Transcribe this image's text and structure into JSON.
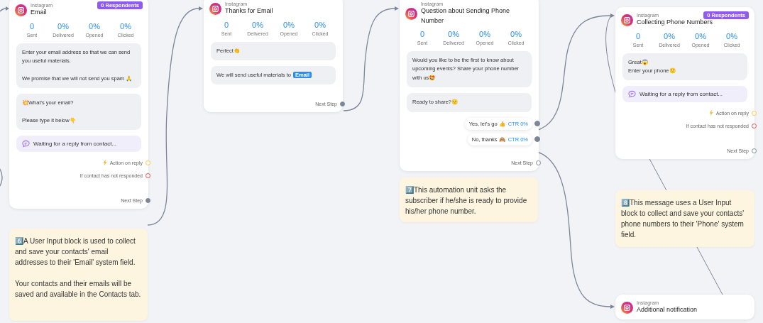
{
  "nodes": [
    {
      "platform": "Instagram",
      "title": "Email",
      "badge": "0 Respondents",
      "stats": [
        {
          "value": "0",
          "label": "Sent"
        },
        {
          "value": "0%",
          "label": "Delivered"
        },
        {
          "value": "0%",
          "label": "Opened"
        },
        {
          "value": "0%",
          "label": "Clicked"
        }
      ],
      "messages": [
        {
          "text": "Enter your email address so that we can send you useful materials.\n\nWe promise that we will not send you spam 🙏"
        },
        {
          "text": "💥What's your email?\n\nPlease type it below👇"
        }
      ],
      "waiting": "Waiting for a reply from contact...",
      "outputs": [
        {
          "kind": "action",
          "label": "Action on reply",
          "connected": false
        },
        {
          "kind": "no-response",
          "label": "If contact has not responded",
          "connected": false
        },
        {
          "kind": "next",
          "label": "Next Step",
          "connected": true
        }
      ]
    },
    {
      "platform": "Instagram",
      "title": "Thanks for Email",
      "stats": [
        {
          "value": "0",
          "label": "Sent"
        },
        {
          "value": "0%",
          "label": "Delivered"
        },
        {
          "value": "0%",
          "label": "Opened"
        },
        {
          "value": "0%",
          "label": "Clicked"
        }
      ],
      "messages": [
        {
          "text": "Perfect👏"
        },
        {
          "text": "We will send useful materials to ",
          "tag": "Email"
        }
      ],
      "outputs": [
        {
          "kind": "next",
          "label": "Next Step",
          "connected": true
        }
      ]
    },
    {
      "platform": "Instagram",
      "title": "Question about Sending Phone Number",
      "stats": [
        {
          "value": "0",
          "label": "Sent"
        },
        {
          "value": "0%",
          "label": "Delivered"
        },
        {
          "value": "0%",
          "label": "Opened"
        },
        {
          "value": "0%",
          "label": "Clicked"
        }
      ],
      "messages": [
        {
          "text": "Would you like to be the first to know about upcoming events? Share your phone number with us🤩"
        },
        {
          "text": "Ready to share?🙂"
        }
      ],
      "buttons": [
        {
          "label": "Yes, let's go 👍",
          "ctr": "CTR 0%"
        },
        {
          "label": "No, thanks 🙈",
          "ctr": "CTR 0%"
        }
      ],
      "outputs": [
        {
          "kind": "next",
          "label": "Next Step",
          "connected": false
        }
      ]
    },
    {
      "platform": "Instagram",
      "title": "Collecting Phone Numbers",
      "badge": "0 Respondents",
      "stats": [
        {
          "value": "0",
          "label": "Sent"
        },
        {
          "value": "0%",
          "label": "Delivered"
        },
        {
          "value": "0%",
          "label": "Opened"
        },
        {
          "value": "0%",
          "label": "Clicked"
        }
      ],
      "messages": [
        {
          "text": "Great😱\nEnter your phone🙂"
        }
      ],
      "waiting": "Waiting for a reply from contact...",
      "outputs": [
        {
          "kind": "action",
          "label": "Action on reply",
          "connected": false
        },
        {
          "kind": "no-response",
          "label": "If contact has not responded",
          "connected": false
        },
        {
          "kind": "next",
          "label": "Next Step",
          "connected": false
        }
      ]
    },
    {
      "platform": "Instagram",
      "title": "Additional notification"
    }
  ],
  "notes": [
    {
      "text": "6️⃣A User Input block is used to collect and save your contacts' email addresses to their 'Email' system field.\n\nYour contacts and their emails will be saved and available in the Contacts tab."
    },
    {
      "text": "7️⃣This automation unit asks the subscriber if he/she is ready to provide his/her phone number."
    },
    {
      "text": "8️⃣This message uses a User Input block to collect and save your contacts' phone numbers to their 'Phone' system field."
    }
  ]
}
